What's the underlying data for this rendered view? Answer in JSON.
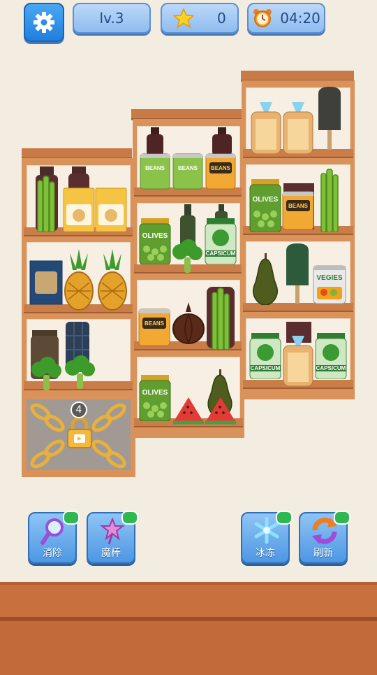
{
  "hud": {
    "level": "lv.3",
    "stars": "0",
    "timer": "04:20"
  },
  "locked": {
    "count": "4"
  },
  "labels": {
    "olives": "OLIVES",
    "capsicum": "CAPSICUM",
    "vegies": "VEGIES",
    "beans": "BEANS"
  },
  "powerups": {
    "clear": "消除",
    "wand": "魔棒",
    "freeze": "冰冻",
    "refresh": "刷新"
  },
  "colors": {
    "button_blue": "#4d97e3",
    "wood": "#d9925a",
    "floor": "#c26a3a"
  }
}
